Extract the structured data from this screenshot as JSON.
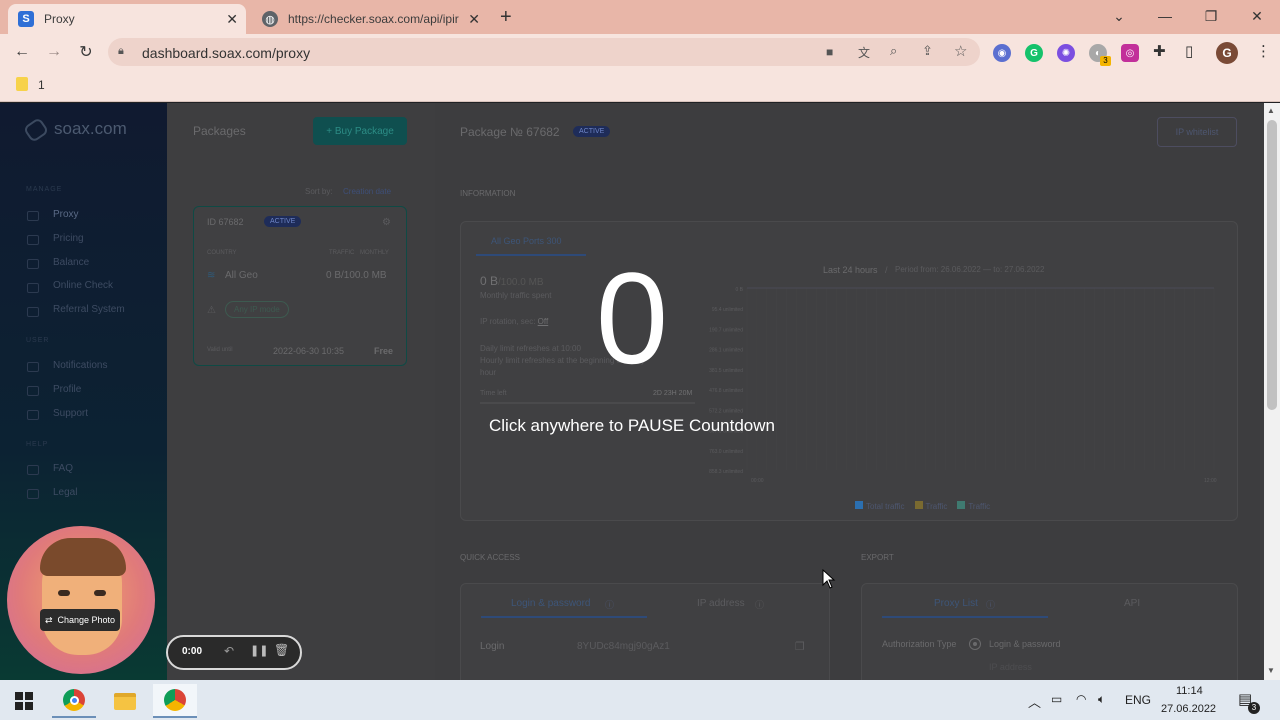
{
  "browser": {
    "tabs": [
      {
        "title": "Proxy",
        "favicon": "S",
        "active": true
      },
      {
        "title": "https://checker.soax.com/api/ipir",
        "favicon": "globe",
        "active": false
      }
    ],
    "url": "dashboard.soax.com/proxy",
    "bookmark": "1",
    "profile_initial": "G",
    "ext_badge": "3"
  },
  "sidebar": {
    "logo": "soax.com",
    "section_manage": "MANAGE",
    "section_user": "USER",
    "section_help": "HELP",
    "items_manage": [
      "Proxy",
      "Pricing",
      "Balance",
      "Online Check",
      "Referral System"
    ],
    "items_user": [
      "Notifications",
      "Profile",
      "Support"
    ],
    "items_help": [
      "FAQ",
      "Legal"
    ]
  },
  "packages": {
    "title": "Packages",
    "buy_button": "+ Buy Package",
    "sort_label": "Sort by:",
    "sort_value": "Creation date",
    "card": {
      "id_label": "ID",
      "id": "67682",
      "status": "ACTIVE",
      "col_left": "COUNTRY",
      "col_traffic": "TRAFFIC",
      "col_period": "MONTHLY",
      "geo": "All Geo",
      "traffic": "0 B/100.0 MB",
      "mode": "Any IP mode",
      "expires_label": "Valid until",
      "expires": "2022-06-30 10:35",
      "plan": "Free"
    }
  },
  "detail": {
    "title": "Package № 67682",
    "status": "ACTIVE",
    "whitelist_button": "IP whitelist",
    "info_heading": "INFORMATION",
    "ports_tab": "All Geo Ports 300",
    "traffic_value": "0 B",
    "traffic_total": "/100.0 MB",
    "traffic_caption": "Monthly traffic spent",
    "rotation_label": "IP rotation, sec:",
    "rotation_value": "Off",
    "limit_text_1": "Daily limit refreshes at 10:00",
    "limit_text_2": "Hourly limit refreshes at the beginning of every",
    "limit_text_3": "hour",
    "time_left_label": "Time left",
    "time_left": "2D 23H 20M",
    "chart_tab_active": "Last 24 hours",
    "chart_tab_sep": "/",
    "chart_period": "Period from: 26.06.2022 — to: 27.06.2022",
    "chart_y": [
      "0 B",
      "95.4 unlimited",
      "190.7 unlimited",
      "286.1 unlimited",
      "381.5 unlimited",
      "476.8 unlimited",
      "572.2 unlimited",
      "667.6 unlimited",
      "763.0 unlimited",
      "858.3 unlimited"
    ],
    "chart_x": [
      "00:00",
      "12:00"
    ],
    "legend": [
      "Total traffic",
      "Traffic",
      "Traffic"
    ],
    "legend_colors": [
      "#2b6fb0",
      "#7a6a30",
      "#3f7a70"
    ],
    "quick_access": "QUICK ACCESS",
    "qa_tab1": "Login & password",
    "qa_tab2": "IP address",
    "login_label": "Login",
    "login_value": "8YUDc84mgj90gAz1",
    "export": "EXPORT",
    "ex_tab1": "Proxy List",
    "ex_tab2": "API",
    "auth_label": "Authorization Type",
    "auth_opt1": "Login & password",
    "auth_opt2": "IP address"
  },
  "overlay": {
    "countdown": "0",
    "message": "Click anywhere to PAUSE Countdown"
  },
  "recorder": {
    "change_photo": "Change Photo",
    "time": "0:00"
  },
  "taskbar": {
    "lang": "ENG",
    "time": "11:14",
    "date": "27.06.2022",
    "notifications": "3"
  }
}
